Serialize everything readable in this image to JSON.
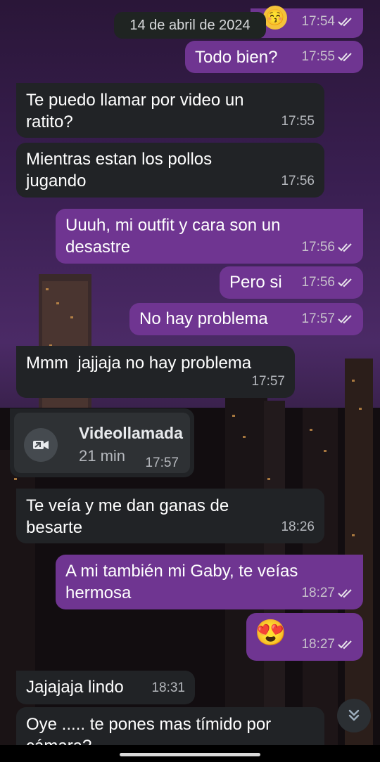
{
  "date_pill": "14 de abril de 2024",
  "messages": [
    {
      "text": "",
      "time": "17:54",
      "dir": "out"
    },
    {
      "text": "Todo bien?",
      "time": "17:55",
      "dir": "out"
    },
    {
      "text": "Te puedo llamar por video un ratito?",
      "time": "17:55",
      "dir": "in"
    },
    {
      "text": "Mientras estan los pollos jugando",
      "time": "17:56",
      "dir": "in"
    },
    {
      "text": "Uuuh, mi outfit y cara son un desastre",
      "time": "17:56",
      "dir": "out"
    },
    {
      "text": "Pero si",
      "time": "17:56",
      "dir": "out"
    },
    {
      "text": "No hay problema",
      "time": "17:57",
      "dir": "out"
    },
    {
      "text": "Mmm  jajjaja no hay problema",
      "time": "17:57",
      "dir": "in"
    },
    {
      "text": "Te veía y me dan ganas de besarte",
      "time": "18:26",
      "dir": "in"
    },
    {
      "text": "A mi también mi Gaby, te veías hermosa",
      "time": "18:27",
      "dir": "out"
    },
    {
      "text": "😍",
      "time": "18:27",
      "dir": "out"
    },
    {
      "text": "Jajajaja lindo",
      "time": "18:31",
      "dir": "in"
    },
    {
      "text": "Oye ..... te pones mas tímido por cámara?",
      "time": "",
      "dir": "in"
    }
  ],
  "video_call": {
    "title": "Videollamada",
    "duration": "21 min",
    "time": "17:57",
    "icon": "video-call-icon"
  },
  "colors": {
    "outgoing": "#6f3591",
    "incoming": "#212326",
    "ticks": "#e8e4ec"
  },
  "scroll_button_icon": "double-chevron-down-icon"
}
